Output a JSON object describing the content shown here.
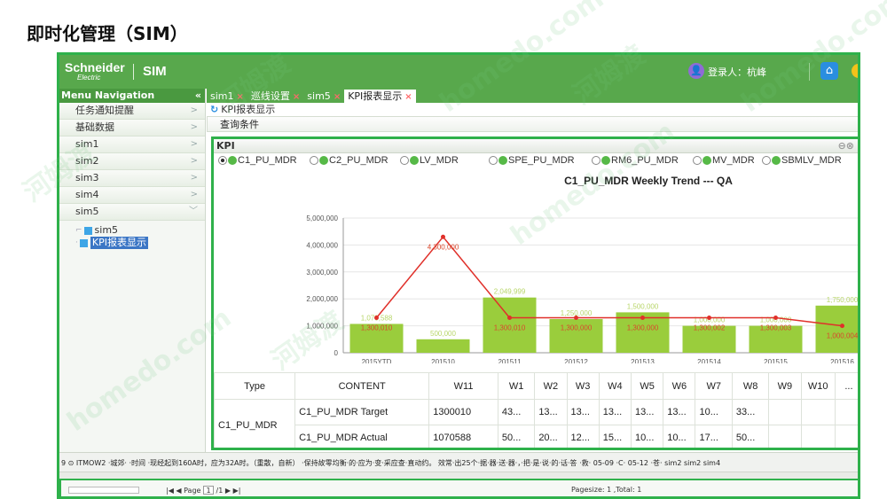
{
  "page_title": "即时化管理（SIM）",
  "topbar": {
    "brand": "Schneider",
    "brand_sub": "Electric",
    "app_name": "SIM",
    "user_label": "登录人：杭峰",
    "user_icon": "user-icon",
    "home_icon": "home-icon"
  },
  "sidebar": {
    "header": "Menu Navigation",
    "collapse_glyph": "«",
    "items": [
      {
        "label": "任务通知提醒"
      },
      {
        "label": "基础数据"
      },
      {
        "label": "sim1"
      },
      {
        "label": "sim2"
      },
      {
        "label": "sim3"
      },
      {
        "label": "sim4"
      },
      {
        "label": "sim5"
      }
    ],
    "tree": [
      {
        "label": "sim5",
        "selected": false
      },
      {
        "label": "KPI报表显示",
        "selected": true
      }
    ]
  },
  "tabs": [
    {
      "label": "sim1",
      "closable": true,
      "active": false
    },
    {
      "label": "巡线设置",
      "closable": true,
      "active": false
    },
    {
      "label": "sim5",
      "closable": true,
      "active": false
    },
    {
      "label": "KPI报表显示",
      "closable": true,
      "active": true
    }
  ],
  "breadcrumb": "KPI报表显示",
  "query_label": "查询条件",
  "kpi": {
    "title": "KPI",
    "radios": [
      {
        "label": "C1_PU_MDR",
        "selected": true
      },
      {
        "label": "C2_PU_MDR",
        "selected": false
      },
      {
        "label": "LV_MDR",
        "selected": false
      },
      {
        "label": "SPE_PU_MDR",
        "selected": false
      },
      {
        "label": "RM6_PU_MDR",
        "selected": false
      },
      {
        "label": "MV_MDR",
        "selected": false
      },
      {
        "label": "SBMLV_MDR",
        "selected": false
      }
    ]
  },
  "chart_data": {
    "type": "bar",
    "title": "C1_PU_MDR Weekly Trend --- QA",
    "categories": [
      "2015YTD",
      "201510",
      "201511",
      "201512",
      "201513",
      "201514",
      "201515",
      "201516"
    ],
    "ylim": [
      0,
      5000000
    ],
    "yticks": [
      "0",
      "1,000,000",
      "2,000,000",
      "3,000,000",
      "4,000,000",
      "5,000,000"
    ],
    "series": [
      {
        "type": "bar",
        "color": "#9acd3c",
        "values": [
          1070588,
          500000,
          2049999,
          1250000,
          1500000,
          1000000,
          1000000,
          1750000
        ],
        "labels": [
          "1,070,588",
          "500,000",
          "2,049,999",
          "1,250,000",
          "1,500,000",
          "1,000,000",
          "1,000,000",
          "1,750,000"
        ]
      },
      {
        "type": "line",
        "color": "#e0302a",
        "values": [
          1300010,
          4300000,
          1300010,
          1300000,
          1300000,
          1300002,
          1300003,
          1000004
        ],
        "labels": [
          "1,300,010",
          "4,300,000",
          "1,300,010",
          "1,300,000",
          "1,300,000",
          "1,300,002",
          "1,300,003",
          "1,000,004"
        ]
      }
    ]
  },
  "table": {
    "headers": [
      "Type",
      "CONTENT",
      "W11",
      "W1",
      "W2",
      "W3",
      "W4",
      "W5",
      "W6",
      "W7",
      "W8",
      "W9",
      "W10",
      "..."
    ],
    "group_label": "C1_PU_MDR",
    "rows": [
      {
        "content": "C1_PU_MDR Target",
        "cells": [
          "1300010",
          "43...",
          "13...",
          "13...",
          "13...",
          "13...",
          "13...",
          "10...",
          "33...",
          "",
          "",
          ""
        ]
      },
      {
        "content": "C1_PU_MDR Actual",
        "cells": [
          "1070588",
          "50...",
          "20...",
          "12...",
          "15...",
          "10...",
          "10...",
          "17...",
          "50...",
          "",
          "",
          ""
        ]
      }
    ]
  },
  "bottom_strip": {
    "row_text": "9  ⊙  ITMOW2  ·城郊·  ·时间 ·现经起到160A时，应为32A时。（重散，自新）  ·保持故零均衡·的·应为·变·采应查·直动约。 效常·出25个·据·器·送·器·，·把·是·说·的·话·答  ·救·  05-09  ·C·  05-12  ·苍·  sim2  sim2  sim4"
  },
  "pager": {
    "nav_text": "|◀ ◀ Page",
    "page_value": "1",
    "nav_after": "/1 ▶ ▶|",
    "info": "Pagesize: 1 ,Total: 1"
  },
  "watermarks": [
    "河姆渡",
    "homedo.com",
    "河姆渡",
    "homedo.com",
    "河姆渡",
    "homedo.com",
    "河姆渡",
    "homedo.com"
  ]
}
